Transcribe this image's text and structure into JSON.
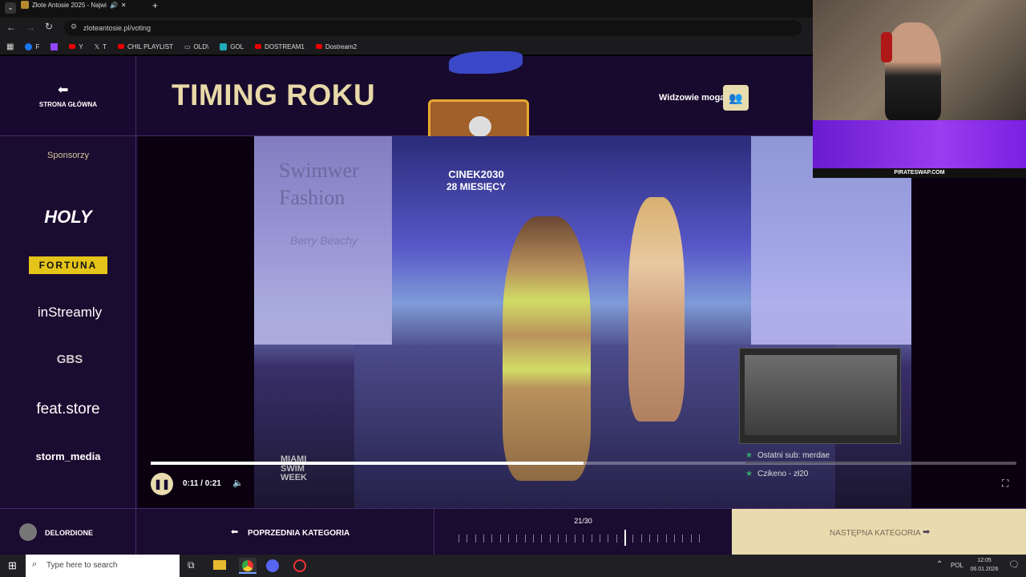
{
  "browser": {
    "tab_title": "Złote Antosie 2025 - Najwi",
    "url": "zloteantosie.pl/voting",
    "bookmarks": [
      "F",
      "Y",
      "T",
      "CHIL PLAYLIST",
      "OLD\\",
      "GOL",
      "DOSTREAM1",
      "Dostream2"
    ]
  },
  "header": {
    "home_label": "STRONA GŁÓWNA",
    "category_title": "TIMING ROKU",
    "viewers_label": "Widzowie mogą",
    "nominee_name": "CINEK2030",
    "nominee_duration": "28 MIESIĘCY"
  },
  "sidebar": {
    "sponsors_heading": "Sponsorzy",
    "sponsors": [
      "HOLY",
      "FORTUNA",
      "inStreamly",
      "GBS",
      "feat.store",
      "storm_media"
    ]
  },
  "video": {
    "watermark_title": "Swimwer\nFashion",
    "watermark_brand": "Berry Beachy",
    "event_logo": "MIAMI SWIM WEEK",
    "current_time": "0:11",
    "duration": "0:21",
    "time_display": "0:11 / 0:21",
    "progress": 0.5
  },
  "stream_overlay": {
    "sponsor_url": "PIRATESWAP.COM",
    "last_sub": "Ostatni sub: merdae",
    "last_donation": "Czikeno - zł20"
  },
  "footer": {
    "user_name": "DELORDIONE",
    "prev_label": "POPRZEDNIA KATEGORIA",
    "next_label": "NASTĘPNA KATEGORIA",
    "progress_text": "21/30",
    "current_step": 21,
    "total_steps": 30
  },
  "taskbar": {
    "search_placeholder": "Type here to search",
    "language": "POL",
    "time": "12:05",
    "date": "06.01.2026"
  },
  "colors": {
    "page_bg": "#180a2e",
    "accent_gold": "#e8d9a8",
    "next_bg": "#e8dcae"
  }
}
